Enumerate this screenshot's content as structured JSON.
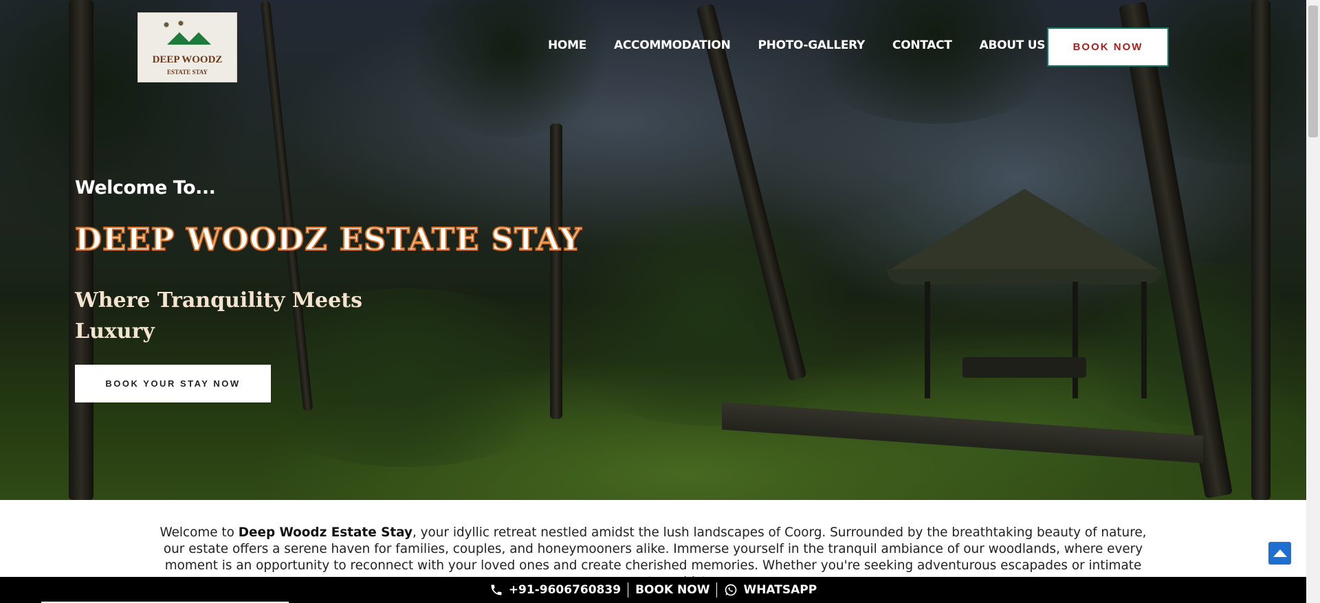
{
  "logo": {
    "name": "DEEP WOODZ",
    "sub": "ESTATE STAY"
  },
  "nav": [
    "HOME",
    "ACCOMMODATION",
    "PHOTO-GALLERY",
    "CONTACT",
    "ABOUT US"
  ],
  "header": {
    "book_now": "BOOK NOW"
  },
  "hero": {
    "welcome": "Welcome To...",
    "title": "DEEP WOODZ ESTATE STAY",
    "subtitle": "Where Tranquility Meets Luxury",
    "cta": "BOOK YOUR STAY NOW"
  },
  "intro": {
    "prefix": "Welcome to ",
    "bold": "Deep Woodz Estate Stay",
    "rest": ", your idyllic retreat nestled amidst the lush landscapes of Coorg. Surrounded by the breathtaking beauty of nature, our estate offers a serene haven for families, couples, and honeymooners alike. Immerse yourself in the tranquil ambiance of our woodlands, where every moment is an opportunity to reconnect with your loved ones and create cherished memories. Whether you're seeking adventurous escapades or intimate moments amidst"
  },
  "bottom_bar": {
    "phone": "+91-9606760839",
    "book": "BOOK NOW",
    "whatsapp": "WHATSAPP"
  },
  "colors": {
    "title_stroke": "#e07020",
    "book_now_text": "#b01e1e",
    "to_top_bg": "#1f6fd0"
  },
  "icons": [
    "phone-icon",
    "whatsapp-icon",
    "arrow-up-icon"
  ]
}
